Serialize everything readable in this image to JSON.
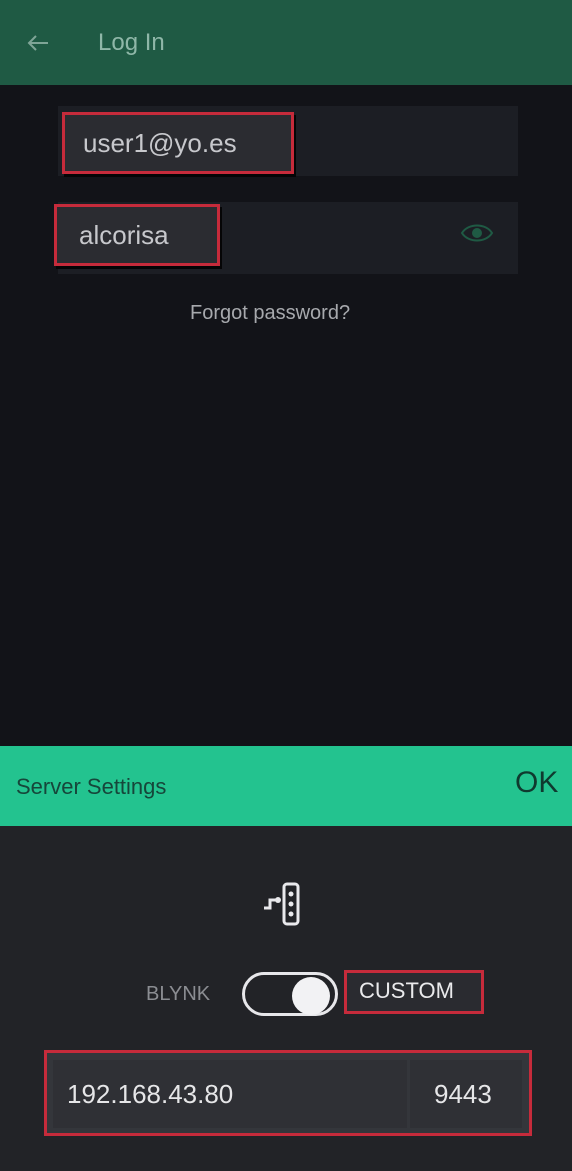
{
  "header": {
    "back_icon": "arrow-left-icon",
    "title": "Log In"
  },
  "login": {
    "email_value": "user1@yo.es",
    "password_value": "alcorisa",
    "eye_icon": "eye-icon",
    "forgot_password": "Forgot password?"
  },
  "server_settings": {
    "title": "Server Settings",
    "ok_label": "OK",
    "server_icon": "server-connection-icon",
    "mode_left_label": "BLYNK",
    "mode_right_label": "CUSTOM",
    "toggle_state": "custom",
    "ip_value": "192.168.43.80",
    "port_value": "9443"
  },
  "colors": {
    "header_bg": "#1f5a44",
    "accent_green": "#23c38f",
    "highlight_red": "#c62b3b",
    "background": "#121318"
  }
}
